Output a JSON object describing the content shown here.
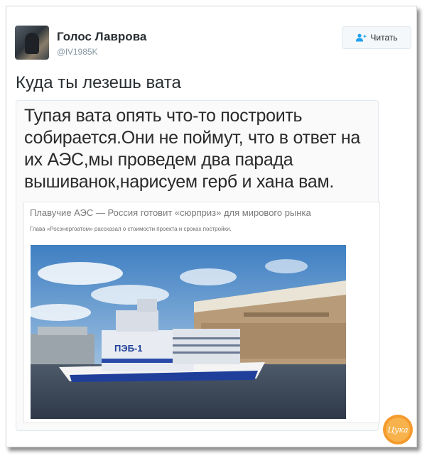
{
  "tweet": {
    "author_name": "Голос Лаврова",
    "author_handle": "@lV1985K",
    "follow_label": "Читать",
    "text": "Куда ты лезешь вата"
  },
  "quote": {
    "text": "Тупая вата опять что-то построить собирается.Они не поймут, что в ответ на их АЭС,мы проведем два парада вышиванок,нарисуем герб и хана вам.",
    "card": {
      "headline": "Плавучие АЭС — Россия готовит «сюрприз» для мирового рынка",
      "subtitle": "Глава «Росэнергоатом» рассказал о стоимости проекта и сроках постройки.",
      "ship_label": "ПЭБ-1"
    }
  },
  "watermark": {
    "text": "Цука"
  },
  "colors": {
    "accent": "#1da1f2",
    "text": "#292f33",
    "muted": "#8899a6"
  }
}
